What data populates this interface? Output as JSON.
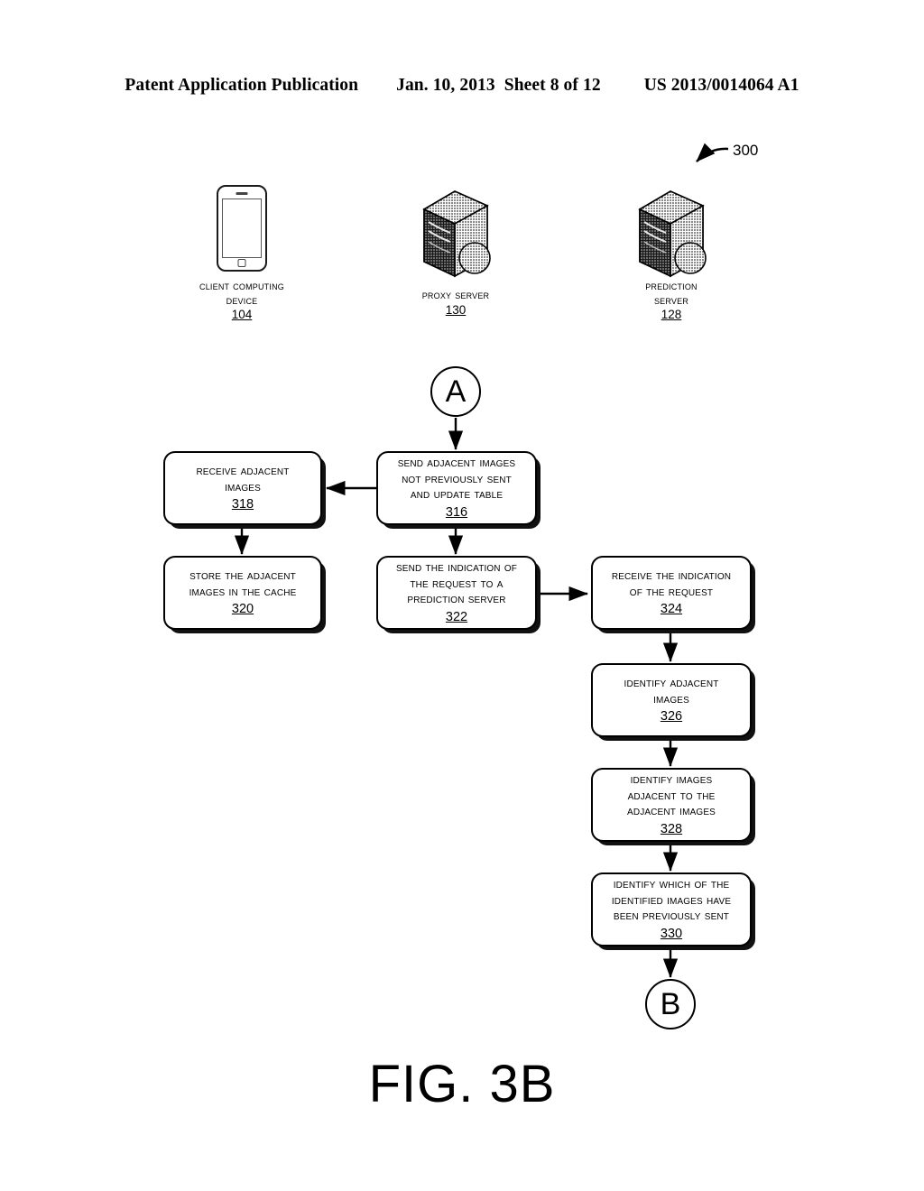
{
  "header": {
    "publication": "Patent Application Publication",
    "date": "Jan. 10, 2013",
    "sheet": "Sheet 8 of 12",
    "patent_number": "US 2013/0014064 A1"
  },
  "figure": {
    "title": "FIG. 3B",
    "reference_numeral": "300"
  },
  "nodes": [
    {
      "icon": "smartphone-icon",
      "lines": [
        "Client Computing",
        "Device"
      ],
      "number": "104"
    },
    {
      "icon": "server-tower-icon",
      "lines": [
        "Proxy Server"
      ],
      "number": "130"
    },
    {
      "icon": "server-tower-icon",
      "lines": [
        "Prediction",
        "Server"
      ],
      "number": "128"
    }
  ],
  "connectors": [
    {
      "label": "A"
    },
    {
      "label": "B"
    }
  ],
  "steps": [
    {
      "id": "316",
      "lines": [
        "Send Adjacent Images",
        "not Previously Sent",
        "and Update Table"
      ],
      "number": "316"
    },
    {
      "id": "318",
      "lines": [
        "Receive Adjacent",
        "Images"
      ],
      "number": "318"
    },
    {
      "id": "320",
      "lines": [
        "Store the Adjacent",
        "Images in the Cache"
      ],
      "number": "320"
    },
    {
      "id": "322",
      "lines": [
        "Send the Indication of",
        "the Request to a",
        "Prediction Server"
      ],
      "number": "322"
    },
    {
      "id": "324",
      "lines": [
        "Receive the Indication",
        "of the Request"
      ],
      "number": "324"
    },
    {
      "id": "326",
      "lines": [
        "Identify Adjacent",
        "Images"
      ],
      "number": "326"
    },
    {
      "id": "328",
      "lines": [
        "Identify Images",
        "Adjacent to the",
        "Adjacent Images"
      ],
      "number": "328"
    },
    {
      "id": "330",
      "lines": [
        "Identify which of the",
        "Identified Images have",
        "been Previously sent"
      ],
      "number": "330"
    }
  ],
  "colors": {
    "ink": "#000000",
    "paper": "#ffffff"
  }
}
